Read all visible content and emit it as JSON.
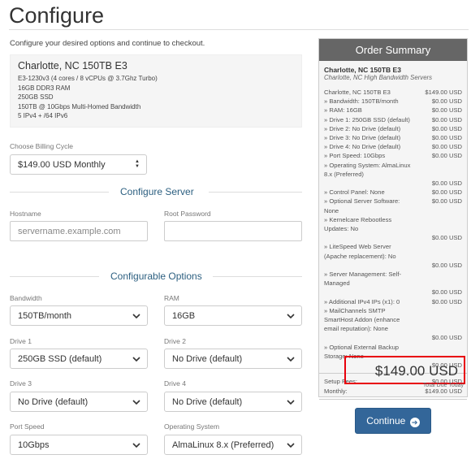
{
  "page": {
    "title": "Configure",
    "intro": "Configure your desired options and continue to checkout."
  },
  "product": {
    "name": "Charlotte, NC 150TB E3",
    "specs": [
      "E3-1230v3 (4 cores / 8 vCPUs @ 3.7Ghz Turbo)",
      "16GB DDR3 RAM",
      "250GB SSD",
      "150TB @ 10Gbps Multi-Homed Bandwidth",
      "5 IPv4 + /64 IPv6"
    ]
  },
  "billing": {
    "label": "Choose Billing Cycle",
    "value": "$149.00 USD Monthly"
  },
  "configure_server": {
    "heading": "Configure Server",
    "hostname_label": "Hostname",
    "hostname_placeholder": "servername.example.com",
    "password_label": "Root Password",
    "password_value": ""
  },
  "options": {
    "heading": "Configurable Options",
    "bandwidth_label": "Bandwidth",
    "bandwidth_value": "150TB/month",
    "ram_label": "RAM",
    "ram_value": "16GB",
    "drive1_label": "Drive 1",
    "drive1_value": "250GB SSD (default)",
    "drive2_label": "Drive 2",
    "drive2_value": "No Drive (default)",
    "drive3_label": "Drive 3",
    "drive3_value": "No Drive (default)",
    "drive4_label": "Drive 4",
    "drive4_value": "No Drive (default)",
    "port_label": "Port Speed",
    "port_value": "10Gbps",
    "os_label": "Operating System",
    "os_value": "AlmaLinux 8.x (Preferred)"
  },
  "summary": {
    "heading": "Order Summary",
    "product": "Charlotte, NC 150TB E3",
    "group": "Charlotte, NC High Bandwidth Servers",
    "lines": [
      {
        "label": "Charlotte, NC 150TB E3",
        "amount": "$149.00 USD"
      },
      {
        "label": "» Bandwidth: 150TB/month",
        "amount": "$0.00 USD"
      },
      {
        "label": "» RAM: 16GB",
        "amount": "$0.00 USD"
      },
      {
        "label": "» Drive 1: 250GB SSD (default)",
        "amount": "$0.00 USD"
      },
      {
        "label": "» Drive 2: No Drive (default)",
        "amount": "$0.00 USD"
      },
      {
        "label": "» Drive 3: No Drive (default)",
        "amount": "$0.00 USD"
      },
      {
        "label": "» Drive 4: No Drive (default)",
        "amount": "$0.00 USD"
      },
      {
        "label": "» Port Speed: 10Gbps",
        "amount": "$0.00 USD"
      },
      {
        "label": "» Operating System: AlmaLinux 8.x (Preferred)",
        "amount": "$0.00 USD",
        "wrap": true
      },
      {
        "label": "» Control Panel: None",
        "amount": "$0.00 USD"
      },
      {
        "label": "» Optional Server Software: None",
        "amount": "$0.00 USD"
      },
      {
        "label": "» Kernelcare Rebootless Updates: No",
        "amount": "$0.00 USD",
        "wrap": true
      },
      {
        "label": "» LiteSpeed Web Server (Apache replacement): No",
        "amount": "$0.00 USD",
        "wrap": true
      },
      {
        "label": "» Server Management: Self-Managed",
        "amount": "$0.00 USD",
        "wrap": true
      },
      {
        "label": "» Additional IPv4 IPs (x1): 0",
        "amount": "$0.00 USD"
      },
      {
        "label": "» MailChannels SMTP SmartHost Addon (enhance email reputation): None",
        "amount": "$0.00 USD",
        "wrap": true
      },
      {
        "label": "» Optional External Backup Storage: None",
        "amount": "$0.00 USD",
        "wrap": true
      }
    ],
    "setup_label": "Setup Fees:",
    "setup_amount": "$0.00 USD",
    "monthly_label": "Monthly:",
    "monthly_amount": "$149.00 USD",
    "total": "$149.00 USD",
    "total_label": "Total Due Today"
  },
  "continue_label": "Continue"
}
